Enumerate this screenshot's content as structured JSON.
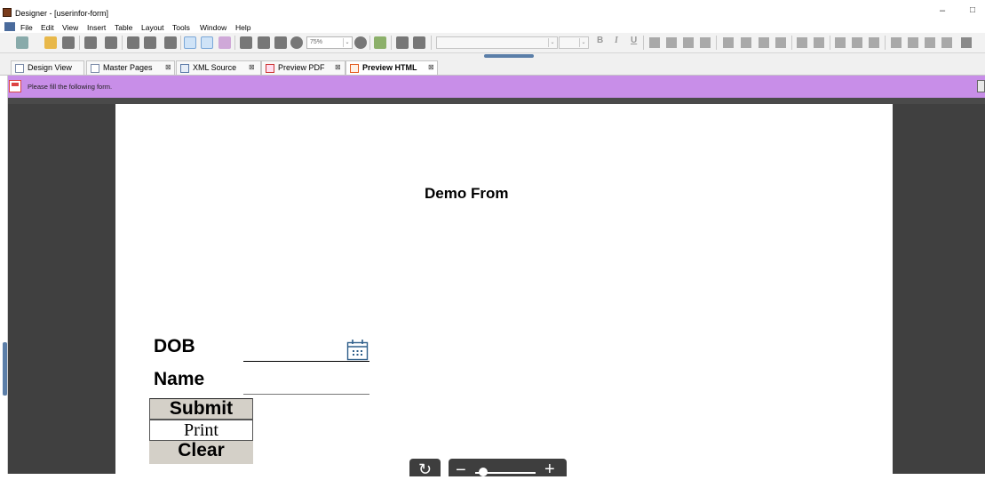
{
  "window": {
    "title": "Designer - [userinfor-form]",
    "minimize": "–",
    "maximize": "□"
  },
  "menu": {
    "items": [
      "File",
      "Edit",
      "View",
      "Insert",
      "Table",
      "Layout",
      "Tools",
      "Window",
      "Help"
    ]
  },
  "toolbar": {
    "zoom_value": "75%",
    "dropdown_arrow": "⌄"
  },
  "tabs": [
    {
      "label": "Design View",
      "icon": "page-icon"
    },
    {
      "label": "Master Pages",
      "icon": "page-icon"
    },
    {
      "label": "XML Source",
      "icon": "xml-icon"
    },
    {
      "label": "Preview PDF",
      "icon": "pdf-icon"
    },
    {
      "label": "Preview HTML",
      "icon": "html-icon",
      "active": true
    }
  ],
  "tab_close_glyph": "⊠",
  "message_bar": {
    "text": "Please fill the following form.",
    "color": "#c88ee8"
  },
  "form": {
    "title": "Demo From",
    "dob_label": "DOB",
    "name_label": "Name",
    "submit_label": "Submit",
    "print_label": "Print",
    "clear_label": "Clear"
  },
  "viewer_controls": {
    "refresh_glyph": "↻",
    "minus_glyph": "−",
    "plus_glyph": "+"
  }
}
